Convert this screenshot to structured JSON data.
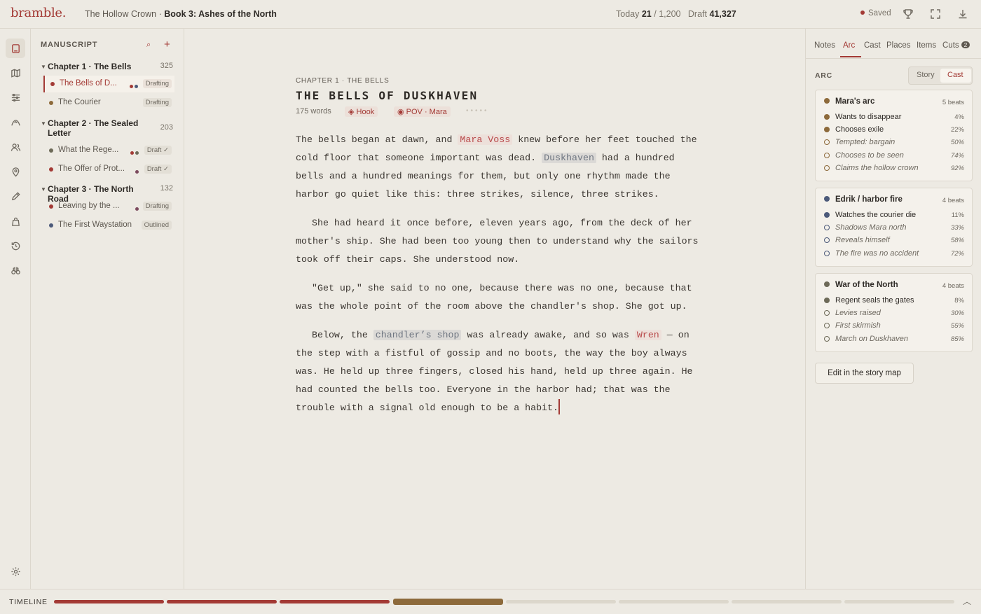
{
  "app": {
    "brand": "bramble.",
    "series": "The Hollow Crown",
    "separator": "·",
    "book": "Book 3: Ashes of the North"
  },
  "counters": {
    "today_label": "Today",
    "today_value": "21",
    "slash": "/",
    "goal": "1,200",
    "draft_label": "Draft",
    "draft_value": "41,327",
    "saved_label": "Saved"
  },
  "colors": {
    "accent": "#a33a35",
    "mara": "#a33a35",
    "brown": "#8d6a3b",
    "edrik": "#4c5a7a",
    "war": "#6d6a58"
  },
  "rail_icons": [
    "book-icon",
    "map-icon",
    "sliders-icon",
    "arc-icon",
    "cast-icon",
    "places-icon",
    "pen-icon",
    "items-icon",
    "history-icon",
    "binoculars-icon"
  ],
  "sidebar": {
    "title": "MANUSCRIPT",
    "search_glyph": "⌕",
    "add_glyph": "+",
    "chapters": [
      {
        "title": "Chapter 1 · The Bells",
        "count": "325",
        "scenes": [
          {
            "title": "The Bells of D...",
            "status": "Drafting",
            "color": "#a33a35"
          },
          {
            "title": "The Courier",
            "status": "Drafting",
            "color": "#8d6a3b"
          }
        ]
      },
      {
        "title": "Chapter 2 · The Sealed Letter",
        "count": "203",
        "scenes": [
          {
            "title": "What the Rege...",
            "status": "Draft ✓",
            "color": "#6d6a58"
          },
          {
            "title": "The Offer of Prot...",
            "status": "Draft ✓",
            "color": "#a33a35"
          }
        ]
      },
      {
        "title": "Chapter 3 · The North Road",
        "count": "132",
        "scenes": [
          {
            "title": "Leaving by the ...",
            "status": "Drafting",
            "color": "#a33a35"
          },
          {
            "title": "The First Waystation",
            "status": "Outlined",
            "color": "#4c5a7a"
          }
        ]
      }
    ]
  },
  "editor": {
    "chapter_label": "CHAPTER 1 · THE BELLS",
    "scene_title": "THE BELLS OF DUSKHAVEN",
    "word_count": "175 words",
    "tag_hook": "◈ Hook",
    "tag_pov": "◉ POV · Mara",
    "p1": {
      "a": "The bells began at dawn, and ",
      "mara": "Mara Voss",
      "b": " knew before her feet touched the cold floor that someone important was dead. ",
      "place": "Duskhaven",
      "c": " had a hundred bells and a hundred meanings for them, but only one rhythm made the harbor go quiet like this: three strikes, silence, three strikes."
    },
    "p2": "She had heard it once before, eleven years ago, from the deck of her mother's ship. She had been too young then to understand why the sailors took off their caps. She understood now.",
    "p3": "\"Get up,\" she said to no one, because there was no one, because that was the whole point of the room above the chandler's shop. She got up.",
    "p4": {
      "a": "Below, the ",
      "place": "chandler’s shop",
      "b": " was already awake, and so was ",
      "wren": "Wren",
      "c": " — on the step with a fistful of gossip and no boots, the way the boy always was. He held up three fingers, closed his hand, held up three again. He had counted the bells too. Everyone in the harbor had; that was the trouble with a signal old enough to be a habit."
    }
  },
  "panel": {
    "tabs": [
      "Notes",
      "Arc",
      "Cast",
      "Places",
      "Items",
      "Cuts"
    ],
    "active_tab": "Arc",
    "cuts_badge": "2",
    "section": "ARC",
    "toggle": {
      "story": "Story",
      "cast": "Cast",
      "selected": "Cast"
    },
    "arcs": [
      {
        "name": "Mara's arc",
        "count": "5 beats",
        "color": "#8d6a3b",
        "beats": [
          {
            "label": "Wants to disappear",
            "pct": "4%",
            "done": true
          },
          {
            "label": "Chooses exile",
            "pct": "22%",
            "done": true
          },
          {
            "label": "Tempted: bargain",
            "pct": "50%",
            "done": false
          },
          {
            "label": "Chooses to be seen",
            "pct": "74%",
            "done": false
          },
          {
            "label": "Claims the hollow crown",
            "pct": "92%",
            "done": false
          }
        ]
      },
      {
        "name": "Edrik / harbor fire",
        "count": "4 beats",
        "color": "#4c5a7a",
        "beats": [
          {
            "label": "Watches the courier die",
            "pct": "11%",
            "done": true
          },
          {
            "label": "Shadows Mara north",
            "pct": "33%",
            "done": false
          },
          {
            "label": "Reveals himself",
            "pct": "58%",
            "done": false
          },
          {
            "label": "The fire was no accident",
            "pct": "72%",
            "done": false
          }
        ]
      },
      {
        "name": "War of the North",
        "count": "4 beats",
        "color": "#6d6a58",
        "beats": [
          {
            "label": "Regent seals the gates",
            "pct": "8%",
            "done": true
          },
          {
            "label": "Levies raised",
            "pct": "30%",
            "done": false
          },
          {
            "label": "First skirmish",
            "pct": "55%",
            "done": false
          },
          {
            "label": "March on Duskhaven",
            "pct": "85%",
            "done": false
          }
        ]
      }
    ],
    "story_map_button": "Edit in the story map"
  },
  "timeline": {
    "label": "TIMELINE",
    "segments": [
      {
        "state": "done",
        "color": "#a33a35"
      },
      {
        "state": "done",
        "color": "#a33a35"
      },
      {
        "state": "done",
        "color": "#a33a35"
      },
      {
        "state": "current",
        "color": "#8d6a3b"
      },
      {
        "state": "pending",
        "color": "#dcd7cc"
      },
      {
        "state": "pending",
        "color": "#dcd7cc"
      },
      {
        "state": "pending",
        "color": "#dcd7cc"
      },
      {
        "state": "pending",
        "color": "#dcd7cc"
      }
    ],
    "collapse_glyph": "︿"
  }
}
